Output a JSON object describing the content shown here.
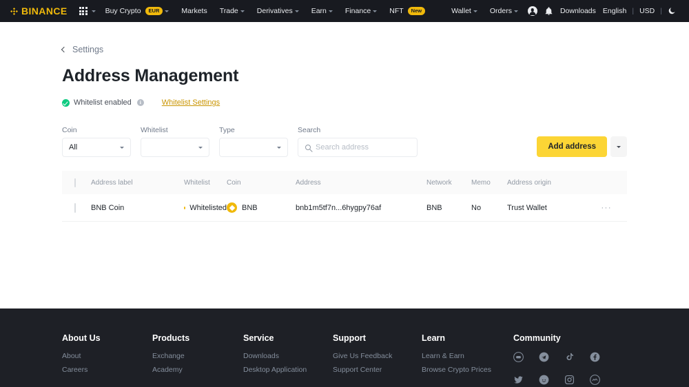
{
  "topnav": {
    "brand": "BINANCE",
    "apps_icon": "grid-apps-icon",
    "items": [
      {
        "label": "Buy Crypto",
        "badge": "EUR",
        "caret": true
      },
      {
        "label": "Markets",
        "badge": "",
        "caret": false
      },
      {
        "label": "Trade",
        "badge": "",
        "caret": true
      },
      {
        "label": "Derivatives",
        "badge": "",
        "caret": true
      },
      {
        "label": "Earn",
        "badge": "",
        "caret": true
      },
      {
        "label": "Finance",
        "badge": "",
        "caret": true
      },
      {
        "label": "NFT",
        "badge": "New",
        "caret": false
      }
    ],
    "right": {
      "wallet": "Wallet",
      "orders": "Orders",
      "downloads": "Downloads",
      "language": "English",
      "currency": "USD",
      "divider": "|",
      "profile_icon": "user-avatar-icon",
      "bell_icon": "notification-bell-icon",
      "theme_icon": "dark-mode-moon-icon"
    }
  },
  "page": {
    "breadcrumb": "Settings",
    "title": "Address Management",
    "whitelist_status": "Whitelist enabled",
    "info_glyph": "i",
    "whitelist_link": "Whitelist Settings"
  },
  "filters": {
    "coin": {
      "label": "Coin",
      "value": "All"
    },
    "whitelist": {
      "label": "Whitelist",
      "value": ""
    },
    "type": {
      "label": "Type",
      "value": ""
    },
    "search": {
      "label": "Search",
      "value": "",
      "placeholder": "Search address"
    },
    "add_button": "Add address"
  },
  "table": {
    "columns": [
      "Address label",
      "Whitelist",
      "Coin",
      "Address",
      "Network",
      "Memo",
      "Address origin"
    ],
    "rows": [
      {
        "address_label": "BNB Coin",
        "whitelist": "Whitelisted",
        "coin": "BNB",
        "address": "bnb1m5tf7n...6hygpy76af",
        "network": "BNB",
        "memo": "No",
        "origin": "Trust Wallet",
        "more": "···"
      }
    ]
  },
  "footer": {
    "columns": [
      {
        "title": "About Us",
        "links": [
          "About",
          "Careers"
        ]
      },
      {
        "title": "Products",
        "links": [
          "Exchange",
          "Academy"
        ]
      },
      {
        "title": "Service",
        "links": [
          "Downloads",
          "Desktop Application"
        ]
      },
      {
        "title": "Support",
        "links": [
          "Give Us Feedback",
          "Support Center"
        ]
      },
      {
        "title": "Learn",
        "links": [
          "Learn & Earn",
          "Browse Crypto Prices"
        ]
      }
    ],
    "community": {
      "title": "Community",
      "icons": [
        "discord-icon",
        "telegram-icon",
        "tiktok-icon",
        "facebook-icon",
        "twitter-icon",
        "reddit-icon",
        "instagram-icon",
        "coinmarketcap-icon"
      ]
    }
  },
  "colors": {
    "brand_yellow": "#f0b90b",
    "button_yellow": "#fcd535",
    "nav_dark": "#181a20",
    "footer_dark": "#1e2026",
    "success_green": "#0ecb81",
    "link_gold": "#c99400"
  }
}
